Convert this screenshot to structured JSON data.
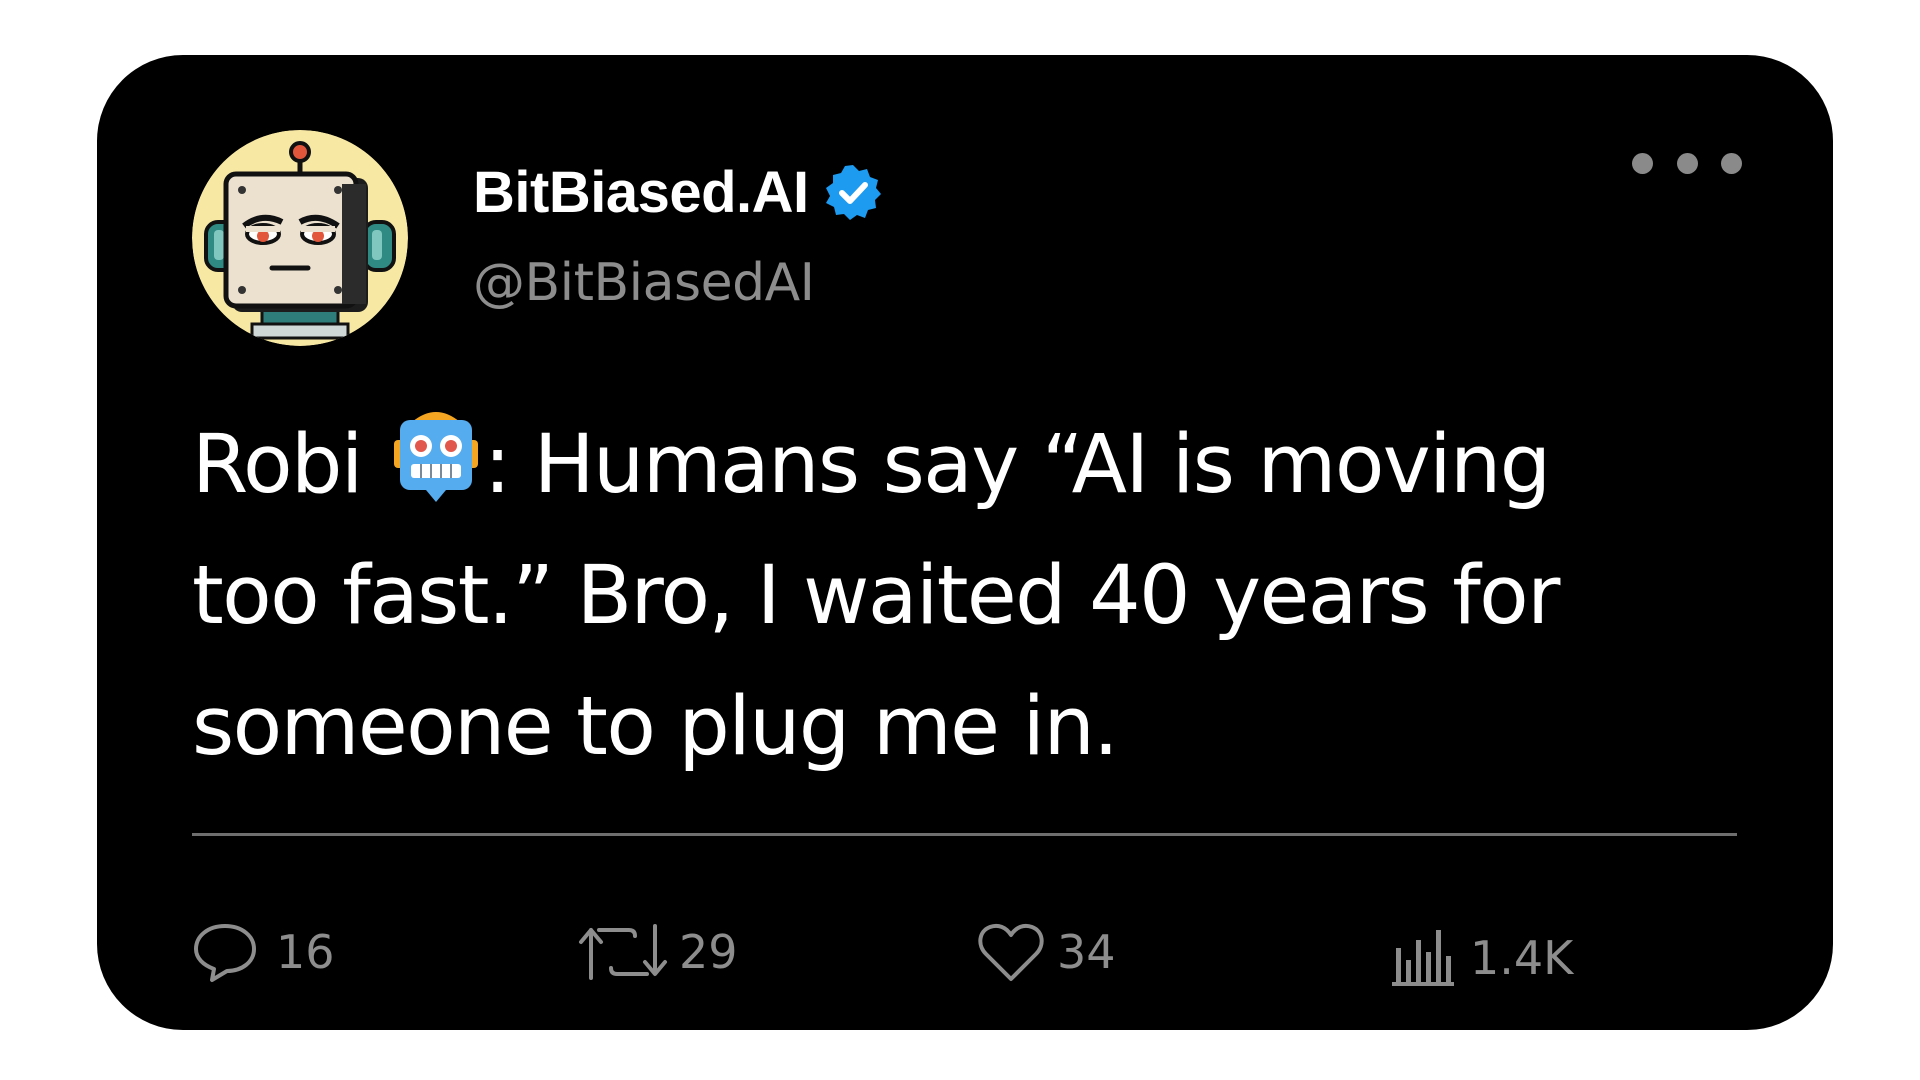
{
  "post": {
    "display_name": "BitBiased.AI",
    "handle": "@BitBiasedAI",
    "verified": true,
    "verified_badge_color": "#1d9bf0",
    "avatar_background": "#f7e8a4",
    "text_lines": [
      {
        "before_emoji": "Robi ",
        "emoji": "robot-face",
        "after_emoji": ": Humans say “AI is moving"
      },
      {
        "text": "too fast.” Bro, I waited 40 years for"
      },
      {
        "text": "someone to plug me in."
      }
    ]
  },
  "actions": {
    "replies": "16",
    "reposts": "29",
    "likes": "34",
    "views": "1.4K"
  },
  "colors": {
    "card_background": "#000000",
    "page_background": "#ffffff",
    "text_primary": "#ffffff",
    "text_secondary": "#8d8d8d",
    "divider": "#6e6e6e"
  }
}
